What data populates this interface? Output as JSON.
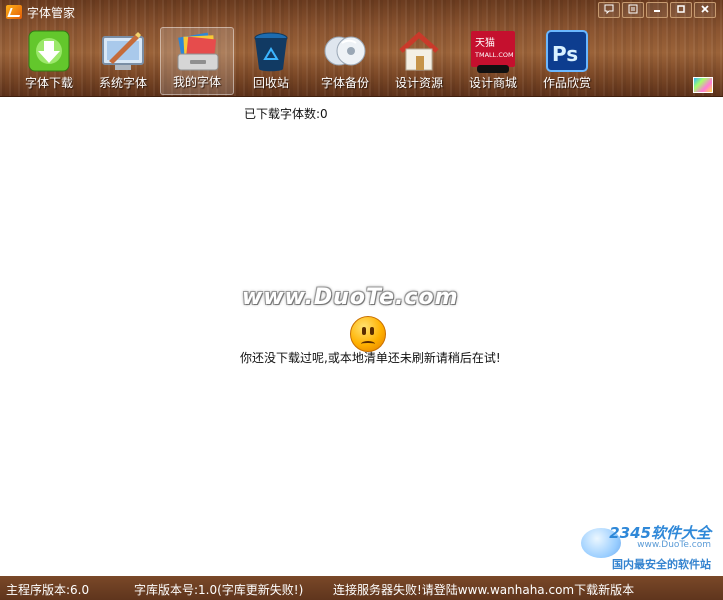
{
  "window": {
    "title": "字体管家",
    "controls": [
      "feedback",
      "menu",
      "minimize",
      "maximize",
      "close"
    ]
  },
  "toolbar": {
    "items": [
      {
        "id": "download",
        "label": "字体下载",
        "icon": "download-icon"
      },
      {
        "id": "system",
        "label": "系统字体",
        "icon": "monitor-brush-icon"
      },
      {
        "id": "mine",
        "label": "我的字体",
        "icon": "font-folder-icon",
        "active": true
      },
      {
        "id": "recycle",
        "label": "回收站",
        "icon": "recycle-bin-icon"
      },
      {
        "id": "backup",
        "label": "字体备份",
        "icon": "disc-backup-icon"
      },
      {
        "id": "resources",
        "label": "设计资源",
        "icon": "house-icon"
      },
      {
        "id": "mall",
        "label": "设计商城",
        "icon": "tmall-icon",
        "logo_text": "天猫\nTMALL.COM"
      },
      {
        "id": "gallery",
        "label": "作品欣赏",
        "icon": "photoshop-icon",
        "logo_text": "Ps"
      }
    ]
  },
  "main": {
    "download_count": "已下载字体数:0",
    "watermark": "www.DuoTe.com",
    "empty_message": "你还没下载过呢,或本地清单还未刷新请稍后在试!"
  },
  "badge": {
    "number": "2345软件大全",
    "url": "www.DuoTe.com",
    "slogan": "国内最安全的软件站"
  },
  "status": {
    "main_version": "主程序版本:6.0",
    "lib_version": "字库版本号:1.0(字库更新失败!)",
    "server_msg": "连接服务器失败!请登陆www.wanhaha.com下载新版本"
  },
  "colors": {
    "wood_dark": "#6a3b1f",
    "wood_light": "#9b6339",
    "status_bg": "#6a3d22"
  }
}
